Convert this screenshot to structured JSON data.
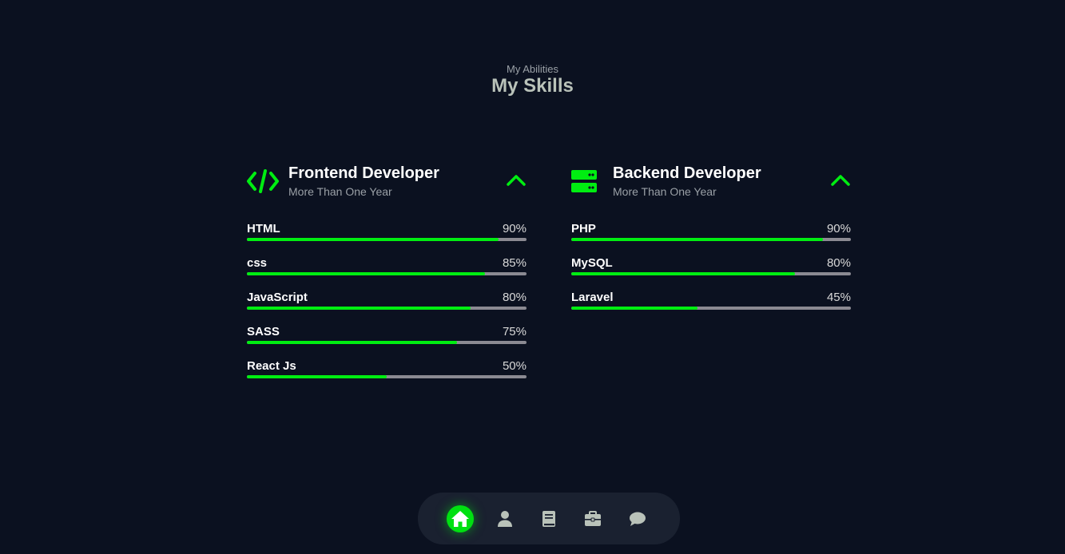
{
  "header": {
    "subtitle": "My Abilities",
    "title": "My Skills"
  },
  "frontend": {
    "title": "Frontend Developer",
    "subtitle": "More Than One Year",
    "icon": "code-icon",
    "skills": [
      {
        "name": "HTML",
        "percent_label": "90%",
        "percent": 90
      },
      {
        "name": "css",
        "percent_label": "85%",
        "percent": 85
      },
      {
        "name": "JavaScript",
        "percent_label": "80%",
        "percent": 80
      },
      {
        "name": "SASS",
        "percent_label": "75%",
        "percent": 75
      },
      {
        "name": "React Js",
        "percent_label": "50%",
        "percent": 50
      }
    ]
  },
  "backend": {
    "title": "Backend Developer",
    "subtitle": "More Than One Year",
    "icon": "server-icon",
    "skills": [
      {
        "name": "PHP",
        "percent_label": "90%",
        "percent": 90
      },
      {
        "name": "MySQL",
        "percent_label": "80%",
        "percent": 80
      },
      {
        "name": "Laravel",
        "percent_label": "45%",
        "percent": 45
      }
    ]
  },
  "nav": {
    "items": [
      {
        "icon": "home-icon",
        "active": true
      },
      {
        "icon": "user-icon",
        "active": false
      },
      {
        "icon": "book-icon",
        "active": false
      },
      {
        "icon": "briefcase-icon",
        "active": false
      },
      {
        "icon": "chat-icon",
        "active": false
      }
    ]
  },
  "colors": {
    "accent": "#00ee11",
    "background": "#0b1120",
    "track": "#8b8a92",
    "navbar": "#1a2130",
    "nav_icon": "#b9c2b9"
  }
}
